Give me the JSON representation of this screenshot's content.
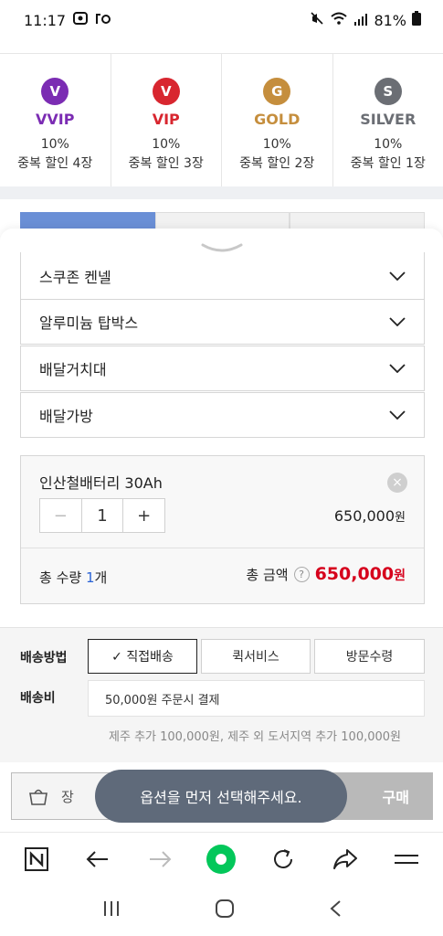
{
  "status": {
    "time": "11:17",
    "battery": "81%"
  },
  "grades": [
    {
      "letter": "V",
      "name": "VVIP",
      "rate": "10%",
      "desc": "중복 할인 4장",
      "color": "#7b2cb3"
    },
    {
      "letter": "V",
      "name": "VIP",
      "rate": "10%",
      "desc": "중복 할인 3장",
      "color": "#d8262f"
    },
    {
      "letter": "G",
      "name": "GOLD",
      "rate": "10%",
      "desc": "중복 할인 2장",
      "color": "#c58e3d"
    },
    {
      "letter": "S",
      "name": "SILVER",
      "rate": "10%",
      "desc": "중복 할인 1장",
      "color": "#6b6e74"
    }
  ],
  "options": [
    {
      "label": "스쿠존 켄넬"
    },
    {
      "label": "알루미늄 탑박스"
    },
    {
      "label": "배달거치대"
    },
    {
      "label": "배달가방"
    }
  ],
  "selected": {
    "name": "인산철배터리 30Ah",
    "qty": "1",
    "price": "650,000",
    "won": "원",
    "minus": "−",
    "plus": "+",
    "close": "×"
  },
  "totals": {
    "qty_label": "총 수량 ",
    "qty_num": "1",
    "qty_unit": "개",
    "amount_label": "총 금액",
    "help": "?",
    "amount": "650,000",
    "won": "원"
  },
  "shipping": {
    "method_label": "배송방법",
    "methods": [
      "✓ 직접배송",
      "퀵서비스",
      "방문수령"
    ],
    "fee_label": "배송비",
    "fee_value": "50,000원 주문시 결제",
    "note": "제주 추가 100,000원, 제주 외 도서지역 추가 100,000원"
  },
  "buy": {
    "cart_label": "장",
    "buy_label": "구매"
  },
  "toast": "옵션을 먼저 선택해주세요."
}
